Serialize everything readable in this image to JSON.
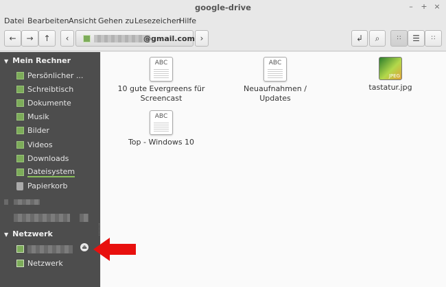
{
  "window": {
    "title": "google-drive",
    "minimize": "–",
    "maximize": "+",
    "close": "×"
  },
  "menu": [
    "Datei",
    "Bearbeiten",
    "Ansicht",
    "Gehen zu",
    "Lesezeichen",
    "Hilfe"
  ],
  "location": {
    "account_suffix": "@gmail.com"
  },
  "sidebar": {
    "computer_header": "Mein Rechner",
    "computer_items": [
      {
        "label": "Persönlicher ...",
        "icon": "folder-icon"
      },
      {
        "label": "Schreibtisch",
        "icon": "folder-icon"
      },
      {
        "label": "Dokumente",
        "icon": "folder-icon"
      },
      {
        "label": "Musik",
        "icon": "folder-icon"
      },
      {
        "label": "Bilder",
        "icon": "folder-icon"
      },
      {
        "label": "Videos",
        "icon": "folder-icon"
      },
      {
        "label": "Downloads",
        "icon": "folder-icon"
      },
      {
        "label": "Dateisystem",
        "icon": "folder-icon",
        "selected": true
      },
      {
        "label": "Papierkorb",
        "icon": "trash-icon"
      }
    ],
    "network_header": "Netzwerk",
    "network_items": [
      {
        "label": "Netzwerk",
        "icon": "network-icon"
      }
    ]
  },
  "files": [
    {
      "name": "10 gute Evergreens für Screencast",
      "type": "document",
      "badge": "ABC"
    },
    {
      "name": "Neuaufnahmen / Updates",
      "type": "document",
      "badge": "ABC"
    },
    {
      "name": "tastatur.jpg",
      "type": "image",
      "badge": "JPEG"
    },
    {
      "name": "Top - Windows 10",
      "type": "document",
      "badge": "ABC"
    }
  ],
  "colors": {
    "sidebar_bg": "#4d4d4d",
    "accent": "#8ac05a",
    "arrow": "#e8100e"
  }
}
